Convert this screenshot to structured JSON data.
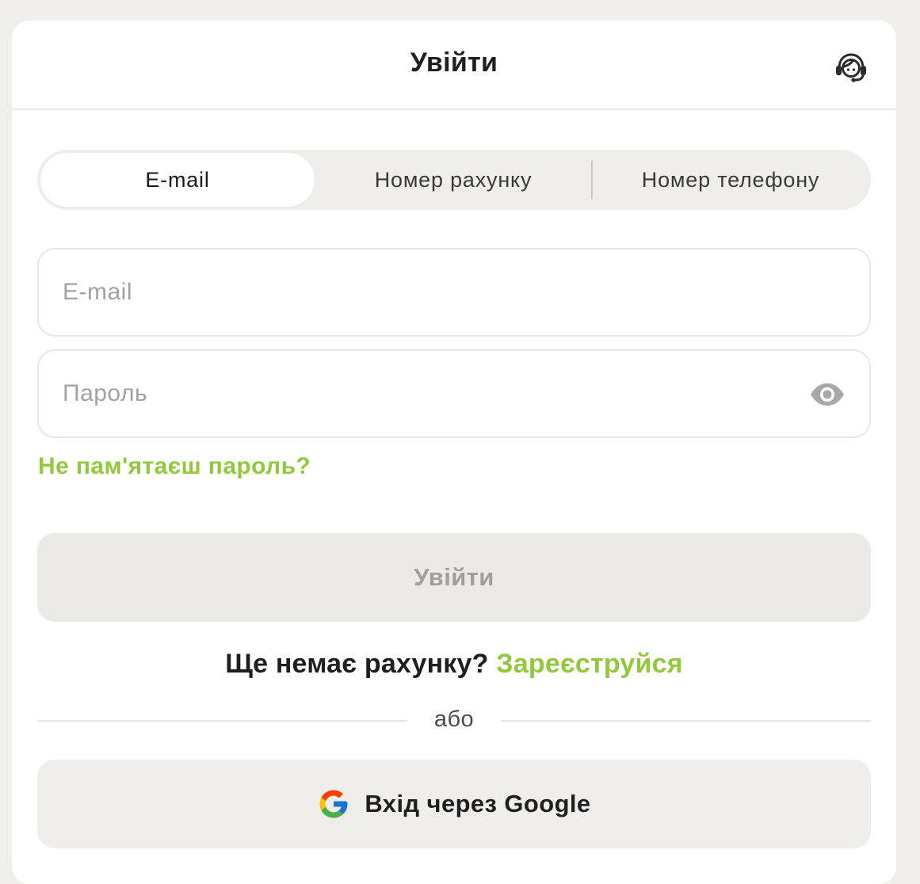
{
  "header": {
    "title": "Увійти",
    "support_icon": "headset-support-icon"
  },
  "tabs": [
    {
      "label": "E-mail",
      "active": true
    },
    {
      "label": "Номер рахунку",
      "active": false
    },
    {
      "label": "Номер телефону",
      "active": false
    }
  ],
  "form": {
    "email": {
      "value": "",
      "placeholder": "E-mail"
    },
    "password": {
      "value": "",
      "placeholder": "Пароль",
      "toggle_icon": "eye-icon"
    },
    "forgot_link": "Не пам'ятаєш пароль?",
    "submit_label": "Увійти"
  },
  "signup": {
    "question": "Ще немає рахунку?",
    "link": "Зареєструйся"
  },
  "divider": {
    "text": "або"
  },
  "google": {
    "label": "Вхід через Google",
    "icon": "google-icon"
  },
  "colors": {
    "page_background": "#f0efeb",
    "card_background": "#ffffff",
    "accent_green": "#92c93c",
    "disabled_button": "#ebeae6",
    "disabled_text": "#a09f9b"
  }
}
